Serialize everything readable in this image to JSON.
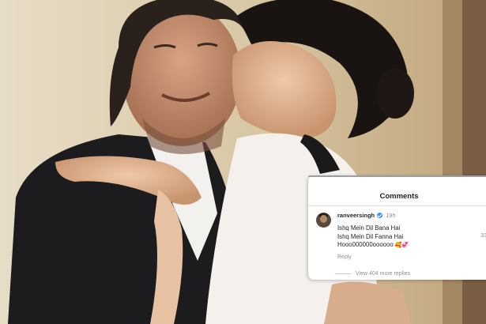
{
  "comments_panel": {
    "title": "Comments",
    "comment": {
      "username": "ranveersingh",
      "time": "19h",
      "lines": [
        "Ishq Mein Dil Bana Hai",
        "Ishq Mein Dil Fanna Hai",
        "Hooo000000oooooo"
      ],
      "emoji": "🥰💞",
      "reply_label": "Reply",
      "likes": "33"
    },
    "view_replies": "View 404 more replies"
  },
  "icons": {
    "verified": "verified-badge-icon",
    "avatar": "avatar"
  }
}
